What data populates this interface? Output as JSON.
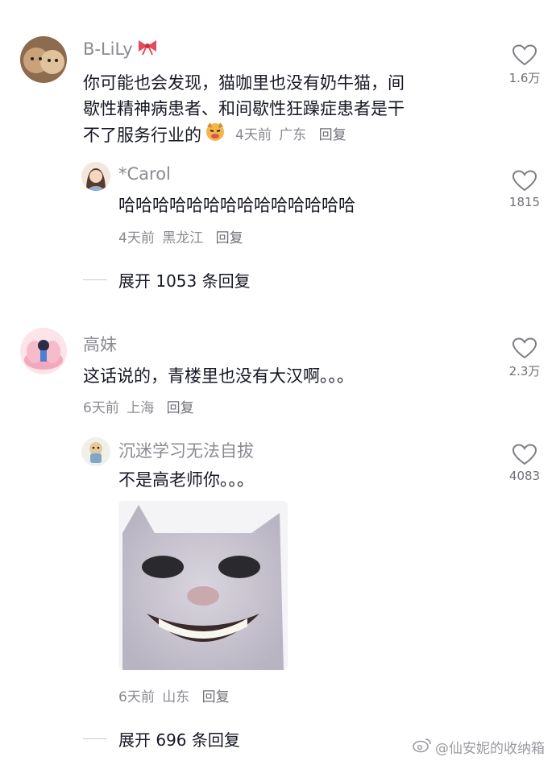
{
  "comments": [
    {
      "username": "B-LiLy",
      "text_lines": [
        "你可能也会发现，猫咖里也没有奶牛猫，间",
        "歇性精神病患者、和间歇性狂躁症患者是干",
        "不了服务行业的"
      ],
      "time": "4天前",
      "location": "广东",
      "reply_label": "回复",
      "likes": "1.6万",
      "has_emoji": true
    },
    {
      "username": "*Carol",
      "text": "哈哈哈哈哈哈哈哈哈哈哈哈哈哈",
      "time": "4天前",
      "location": "黑龙江",
      "reply_label": "回复",
      "likes": "1815"
    },
    {
      "username": "高妹",
      "text": "这话说的，青楼里也没有大汉啊。。。",
      "time": "6天前",
      "location": "上海",
      "reply_label": "回复",
      "likes": "2.3万"
    },
    {
      "username": "沉迷学习无法自拔",
      "text": "不是高老师你。。。",
      "time": "6天前",
      "location": "山东",
      "reply_label": "回复",
      "likes": "4083"
    }
  ],
  "expand_replies": [
    {
      "label": "展开 1053 条回复"
    },
    {
      "label": "展开 696 条回复"
    }
  ],
  "watermark": "@仙安妮的收纳箱",
  "icons": {
    "like": "heart-outline-icon",
    "emoji": "dog-face-emoji-icon",
    "bow": "red-bow-icon",
    "watermark": "weibo-logo-icon"
  },
  "colors": {
    "text": "#161823",
    "meta": "#8a8b91",
    "icon_stroke": "#7d7e84"
  }
}
